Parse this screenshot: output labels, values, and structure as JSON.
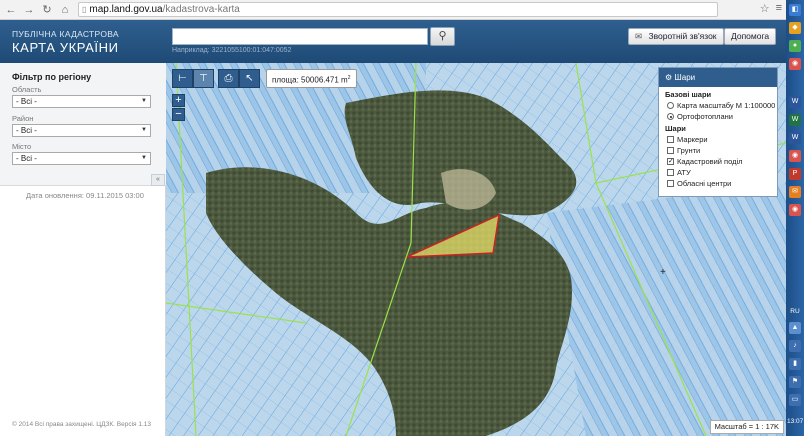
{
  "browser": {
    "url_host": "map.land.gov.ua",
    "url_path": "/kadastrova-karta"
  },
  "header": {
    "brand_line1": "ПУБЛІЧНА КАДАСТРОВА",
    "brand_line2": "КАРТА УКРАЇНИ",
    "search_hint": "Наприклад: 3221055100:01:047:0052",
    "feedback_label": "Зворотній зв'язок",
    "help_label": "Допомога"
  },
  "sidebar": {
    "filter_title": "Фільтр по регіону",
    "fields": [
      {
        "label": "Область",
        "value": "- Всі -"
      },
      {
        "label": "Район",
        "value": "- Всі -"
      },
      {
        "label": "Місто",
        "value": "- Всі -"
      }
    ],
    "update_date": "Дата оновлення: 09.11.2015 03:00",
    "copyright": "© 2014 Всі права захищені. ЦДЗК. Версія 1.13"
  },
  "map": {
    "area_prefix": "площа: 50006.471 m",
    "area_unit_sup": "2",
    "zoom_in": "+",
    "zoom_out": "−",
    "scale_label": "Масштаб = 1 : 17K",
    "layers": {
      "title": "Шари",
      "base_title": "Базові шари",
      "base_options": [
        {
          "label": "Карта масштабу М 1:100000",
          "selected": false
        },
        {
          "label": "Ортофотоплани",
          "selected": true
        }
      ],
      "overlay_title": "Шари",
      "overlay_options": [
        {
          "label": "Маркери",
          "checked": false
        },
        {
          "label": "Грунти",
          "checked": false
        },
        {
          "label": "Кадастровий поділ",
          "checked": true
        },
        {
          "label": "АТУ",
          "checked": false
        },
        {
          "label": "Обласні центри",
          "checked": false
        }
      ]
    }
  },
  "taskbar": {
    "lang": "RU",
    "time": "13:07"
  },
  "colors": {
    "header_blue": "#2f5f8f",
    "parcel_fill": "#8fc3f0",
    "selected_parcel": "#e8e06a",
    "selected_outline": "#d02020"
  }
}
